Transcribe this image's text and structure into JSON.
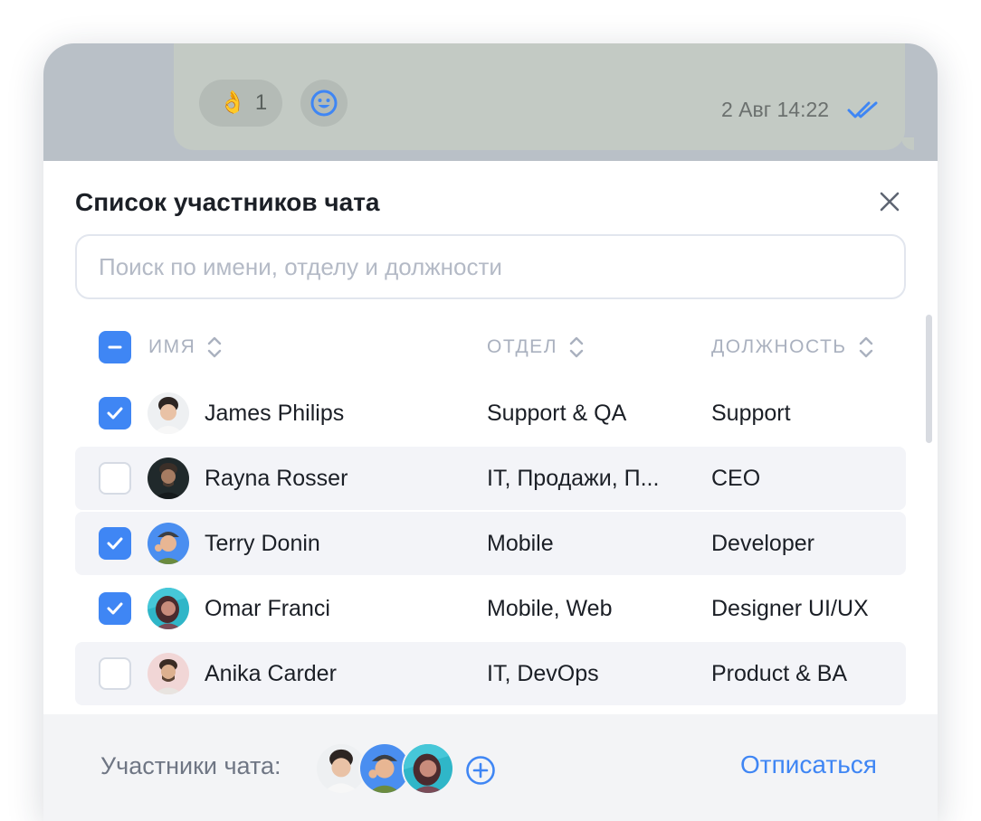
{
  "message": {
    "reaction_emoji": "👌",
    "reaction_count": "1",
    "time": "2 Авг 14:22"
  },
  "panel": {
    "title": "Список участников чата",
    "search_placeholder": "Поиск по имени, отделу и должности",
    "columns": {
      "name": "Имя",
      "department": "Отдел",
      "position": "Должность"
    },
    "rows": [
      {
        "name": "James Philips",
        "department": "Support & QA",
        "position": "Support",
        "checked": true
      },
      {
        "name": "Rayna Rosser",
        "department": "IT, Продажи, П...",
        "position": "CEO",
        "checked": false
      },
      {
        "name": "Terry Donin",
        "department": "Mobile",
        "position": "Developer",
        "checked": true
      },
      {
        "name": "Omar Franci",
        "department": "Mobile, Web",
        "position": "Designer UI/UX",
        "checked": true
      },
      {
        "name": "Anika Carder",
        "department": "IT, DevOps",
        "position": "Product & BA",
        "checked": false
      }
    ]
  },
  "footer": {
    "members_label": "Участники чата:",
    "unsubscribe_label": "Отписаться"
  },
  "icons": {
    "close": "close-icon",
    "sort": "sort-icon",
    "add": "plus-circle-icon",
    "smile": "smile-icon",
    "read": "double-check-icon"
  },
  "colors": {
    "accent": "#3f86f4",
    "muted": "#aab1bf",
    "text": "#1b1f26"
  }
}
